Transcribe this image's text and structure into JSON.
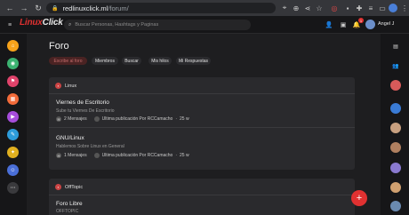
{
  "browser": {
    "url_host": "redlinuxclick.ml",
    "url_path": "/forum/",
    "back": "←",
    "forward": "→",
    "reload": "↻",
    "lock": "🔒",
    "ext_icons": [
      "⌖",
      "⊕",
      "⋖",
      "☆",
      "◎",
      "▪",
      "✚",
      "≡",
      "▭",
      "⋮"
    ]
  },
  "site": {
    "menu_icon": "≡",
    "logo_part1": "Linux",
    "logo_part2": "Click",
    "search_placeholder": "Buscar Personas, Hashtags y Paginas",
    "user_name": "Angel J",
    "notification_count": "1"
  },
  "page": {
    "title": "Foro",
    "tabs": [
      {
        "label": "Escribe al foro",
        "active": true
      },
      {
        "label": "Miembros",
        "active": false
      },
      {
        "label": "Buscar",
        "active": false
      },
      {
        "label": "Mis hilos",
        "active": false
      },
      {
        "label": "Mi Respuestas",
        "active": false
      }
    ]
  },
  "categories": [
    {
      "name": "Linux",
      "forums": [
        {
          "title": "Viernes de Escritorio",
          "description": "Sube tu Viernes De Escritorio",
          "messages": "2 Mensajes",
          "last_post": "Ultima publicación Por RCCamacho",
          "age": "25 w"
        },
        {
          "title": "GNU/Linux",
          "description": "Hablemos Sobre Linux en General",
          "messages": "1 Mensajes",
          "last_post": "Ultima publicación Por RCCamacho",
          "age": "25 w"
        }
      ]
    },
    {
      "name": "OffTopic",
      "forums": [
        {
          "title": "Foro Libre",
          "description": "OFFTOPIC"
        }
      ]
    }
  ],
  "fab_label": "+",
  "colors": {
    "accent": "#e03131",
    "card": "#2a2a2d",
    "background": "#1e1e20"
  }
}
